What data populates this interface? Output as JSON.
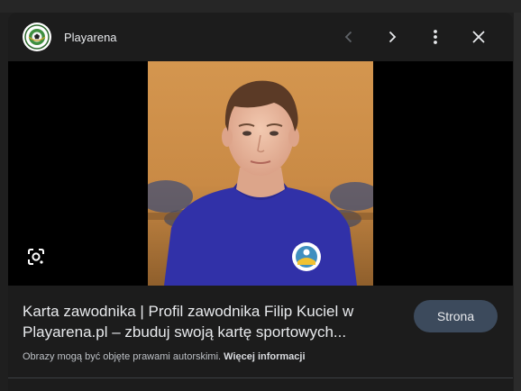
{
  "header": {
    "site_name": "Playarena",
    "logo_icon": "playarena-ball-logo",
    "prev_icon": "chevron-left-icon",
    "next_icon": "chevron-right-icon",
    "more_icon": "more-vert-icon",
    "close_icon": "close-icon"
  },
  "image": {
    "lens_icon": "google-lens-icon"
  },
  "caption": {
    "title": "Karta zawodnika | Profil zawodnika Filip Kuciel w Playarena.pl – zbuduj swoją kartę sportowych...",
    "visit_label": "Strona",
    "copyright_text": "Obrazy mogą być objęte prawami autorskimi.",
    "more_info_label": "Więcej informacji"
  },
  "colors": {
    "panel_bg": "#1c1c1c",
    "button_bg": "#3c4a5c",
    "text_primary": "#e8eaed",
    "text_secondary": "#bdc1c6"
  }
}
